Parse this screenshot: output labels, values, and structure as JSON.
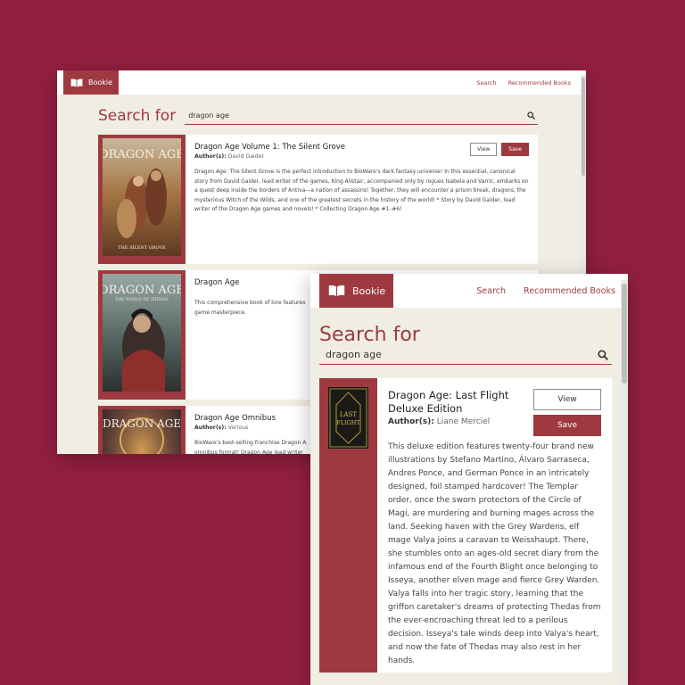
{
  "colors": {
    "background": "#921f42",
    "accent": "#9e3a3f",
    "page": "#f0ede3",
    "card": "#ffffff"
  },
  "icons": {
    "brand": "open-book-icon",
    "search": "search-icon"
  },
  "back_window": {
    "brand": "Bookie",
    "nav": {
      "search": "Search",
      "recommended": "Recommended Books"
    },
    "search_heading": "Search for",
    "search_query": "dragon age",
    "results": [
      {
        "title": "Dragon Age Volume 1: The Silent Grove",
        "author_label": "Author(s):",
        "author": "David Gaider",
        "description": "Dragon Age: The Silent Grove is the perfect introduction to BioWare's dark fantasy universe! In this essential, canonical story from David Gaider, lead writer of the games, King Alistair, accompanied only by rogues Isabela and Varric, embarks on a quest deep inside the borders of Antiva—a nation of assassins! Together, they will encounter a prison break, dragons, the mysterious Witch of the Wilds, and one of the greatest secrets in the history of the world! * Story by David Gaider, lead writer of the Dragon Age games and novels! * Collecting Dragon Age #1–#6!",
        "view": "View",
        "save": "Save",
        "cover_title": "DRAGON AGE",
        "cover_subtitle": "THE SILENT GROVE"
      },
      {
        "title": "Dragon Age",
        "author_label": "",
        "author": "",
        "description": "This comprehensive book of lore features game masterpiece.",
        "view": "",
        "save": "",
        "cover_title": "DRAGON AGE",
        "cover_subtitle": "THE WORLD OF THEDAS"
      },
      {
        "title": "Dragon Age Omnibus",
        "author_label": "Author(s):",
        "author": "Various",
        "description": "BioWare's best-selling franchise Dragon A omnibus format! Dragon Age lead writer fate of his father. Collects Dragon Age m",
        "view": "",
        "save": "",
        "cover_title": "DRAGON AGE",
        "cover_subtitle": ""
      }
    ]
  },
  "front_window": {
    "brand": "Bookie",
    "nav": {
      "search": "Search",
      "recommended": "Recommended Books"
    },
    "search_heading": "Search for",
    "search_query": "dragon age",
    "result": {
      "title": "Dragon Age: Last Flight Deluxe Edition",
      "author_label": "Author(s):",
      "author": "Liane Merciel",
      "view": "View",
      "save": "Save",
      "cover_title_1": "LAST",
      "cover_title_2": "FLIGHT",
      "description": "This deluxe edition features twenty-four brand new illustrations by Stefano Martino, Álvaro Sarraseca, Andres Ponce, and German Ponce in an intricately designed, foil stamped hardcover! The Templar order, once the sworn protectors of the Circle of Magi, are murdering and burning mages across the land. Seeking haven with the Grey Wardens, elf mage Valya joins a caravan to Weisshaupt. There, she stumbles onto an ages-old secret diary from the infamous end of the Fourth Blight once belonging to Isseya, another elven mage and fierce Grey Warden. Valya falls into her tragic story, learning that the griffon caretaker's dreams of protecting Thedas from the ever-encroaching threat led to a perilous decision. Isseya's tale winds deep into Valya's heart, and now the fate of Thedas may also rest in her hands."
    }
  }
}
